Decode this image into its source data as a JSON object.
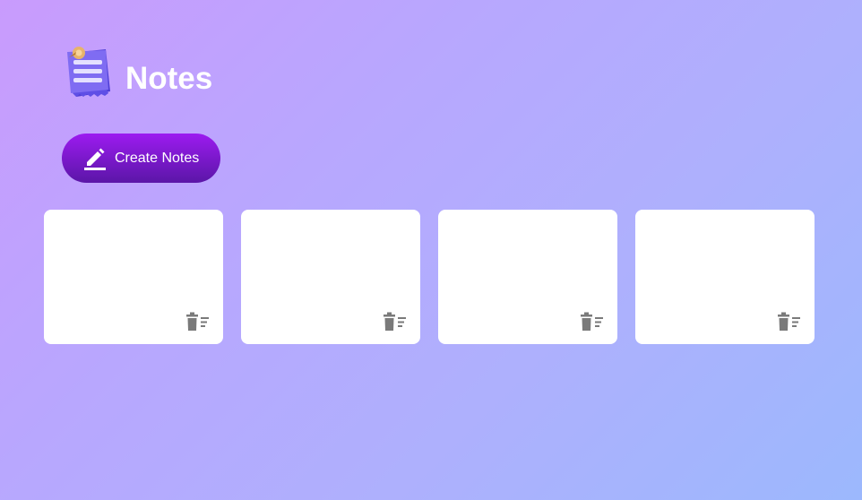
{
  "header": {
    "title": "Notes",
    "logo_icon": "notes-logo-icon"
  },
  "create_button": {
    "label": "Create Notes",
    "icon": "edit-icon"
  },
  "notes": [
    {
      "text": "",
      "delete_icon": "delete-sweep-icon"
    },
    {
      "text": "",
      "delete_icon": "delete-sweep-icon"
    },
    {
      "text": "",
      "delete_icon": "delete-sweep-icon"
    },
    {
      "text": "",
      "delete_icon": "delete-sweep-icon"
    }
  ],
  "colors": {
    "background_start": "#c99bfd",
    "background_end": "#9cb8fd",
    "button_top": "#9c1bf0",
    "button_bottom": "#5b16a7",
    "card": "#ffffff",
    "delete_icon": "#7a7a7a"
  }
}
